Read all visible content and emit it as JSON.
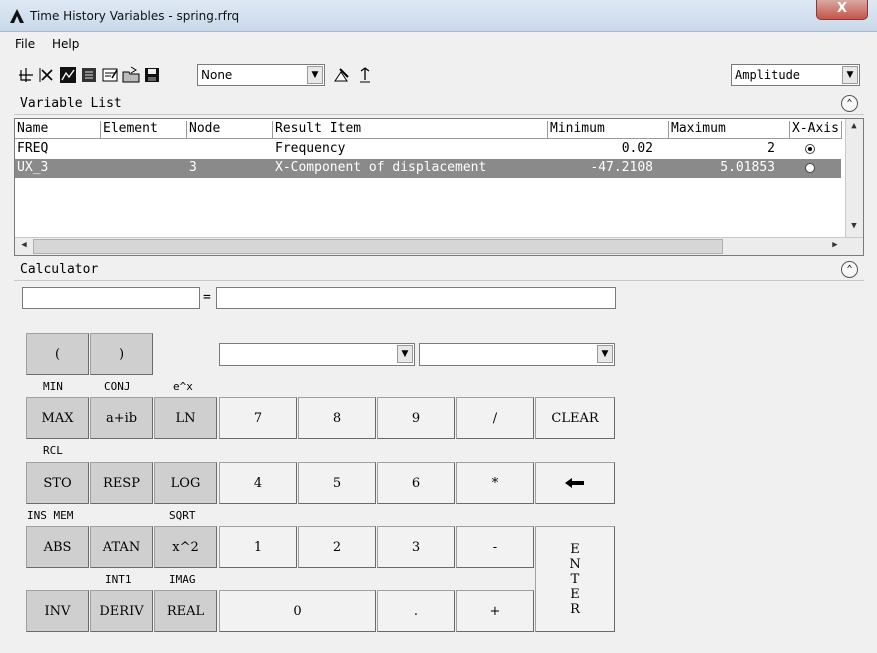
{
  "window": {
    "title": "Time History Variables - spring.rfrq",
    "close_label": "X"
  },
  "menu": {
    "file": "File",
    "help": "Help"
  },
  "toolbar": {
    "icons": [
      "add-data-icon",
      "delete-icon",
      "graph-icon",
      "list-icon",
      "properties-icon",
      "import-icon",
      "save-icon",
      "clear-icon",
      "refresh-icon"
    ],
    "variable_combo": "None",
    "mode_combo": "Amplitude"
  },
  "variable_list": {
    "title": "Variable List",
    "columns": [
      "Name",
      "Element",
      "Node",
      "Result Item",
      "Minimum",
      "Maximum",
      "X-Axis"
    ],
    "rows": [
      {
        "name": "FREQ",
        "element": "",
        "node": "",
        "result_item": "Frequency",
        "minimum": "0.02",
        "maximum": "2",
        "x_axis": true
      },
      {
        "name": "UX_3",
        "element": "",
        "node": "3",
        "result_item": "X-Component of displacement",
        "minimum": "-47.2108",
        "maximum": "5.01853",
        "x_axis": false
      }
    ]
  },
  "calculator": {
    "title": "Calculator",
    "equals": "=",
    "variable_name": "",
    "expression": "",
    "select1": "",
    "select2": "",
    "func_labels": {
      "min": "MIN",
      "conj": "CONJ",
      "exp": "e^x",
      "rcl": "RCL",
      "ins_mem": "INS MEM",
      "sqrt": "SQRT",
      "int1": "INT1",
      "imag": "IMAG"
    },
    "buttons": {
      "lparen": "(",
      "rparen": ")",
      "max": "MAX",
      "aib": "a+ib",
      "ln": "LN",
      "sto": "STO",
      "resp": "RESP",
      "log": "LOG",
      "abs": "ABS",
      "atan": "ATAN",
      "xsq": "x^2",
      "inv": "INV",
      "deriv": "DERIV",
      "real": "REAL",
      "d7": "7",
      "d8": "8",
      "d9": "9",
      "div": "/",
      "clear": "CLEAR",
      "d4": "4",
      "d5": "5",
      "d6": "6",
      "mul": "*",
      "back": "◆",
      "d1": "1",
      "d2": "2",
      "d3": "3",
      "minus": "-",
      "d0": "0",
      "dot": ".",
      "plus": "+",
      "enter": "ENTER"
    }
  }
}
